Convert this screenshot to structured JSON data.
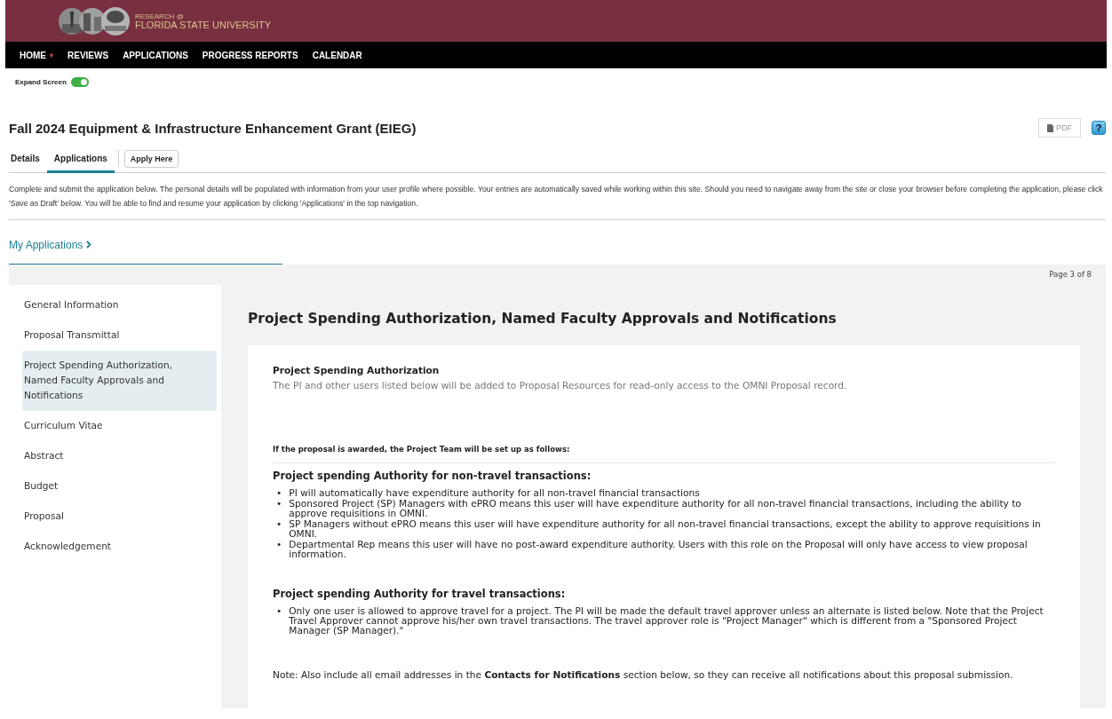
{
  "header": {
    "logo_line1": "RESEARCH @",
    "logo_line2": "FLORIDA STATE UNIVERSITY"
  },
  "nav": [
    {
      "label": "HOME",
      "caret": "▾"
    },
    {
      "label": "REVIEWS"
    },
    {
      "label": "APPLICATIONS"
    },
    {
      "label": "PROGRESS REPORTS"
    },
    {
      "label": "CALENDAR"
    }
  ],
  "expand_screen": {
    "label": "Expand Screen",
    "on": true
  },
  "title": "Fall 2024 Equipment & Infrastructure Enhancement Grant (EIEG)",
  "pdf_button": "PDF",
  "help_button": "?",
  "tabs": [
    {
      "label": "Details",
      "selected": false
    },
    {
      "label": "Applications",
      "selected": true
    }
  ],
  "apply_button": "Apply Here",
  "intro": "Complete and submit the application below. The personal details will be populated with information from your user profile where possible. Your entries are automatically saved while working within this site. Should you need to navigate away from the site or close your browser before completing the application, please click 'Save as Draft' below. You will be able to find and resume your application by clicking 'Applications' in the top navigation.",
  "my_applications": "My Applications",
  "page_indicator": "Page 3 of 8",
  "steps": [
    {
      "label": "General Information",
      "selected": false
    },
    {
      "label": "Proposal Transmittal",
      "selected": false
    },
    {
      "label": "Project Spending Authorization, Named Faculty Approvals and Notifications",
      "selected": true
    },
    {
      "label": "Curriculum Vitae",
      "selected": false
    },
    {
      "label": "Abstract",
      "selected": false
    },
    {
      "label": "Budget",
      "selected": false
    },
    {
      "label": "Proposal",
      "selected": false
    },
    {
      "label": "Acknowledgement",
      "selected": false
    }
  ],
  "section_title": "Project Spending Authorization, Named Faculty Approvals and Notifications",
  "card": {
    "heading": "Project Spending Authorization",
    "subtext": "The PI and other users listed below will be added to Proposal Resources for read-only access to the OMNI Proposal record.",
    "awarded_note": "If the proposal is awarded, the Project Team will be set up as follows:",
    "bullet_marker": "•",
    "groups": [
      {
        "heading": "Project spending Authority for non-travel transactions:",
        "bullets": [
          "PI will automatically have expenditure authority for all non-travel financial transactions",
          "Sponsored Project (SP) Managers with ePRO means this user will have expenditure authority for all non-travel financial transactions, including the ability to approve requisitions in OMNI.",
          "SP Managers without ePRO means this user will have expenditure authority for all non-travel financial transactions, except the ability to approve requisitions in OMNI.",
          "Departmental Rep means this user will have no post-award expenditure authority. Users with this role on the Proposal will only have access to view proposal information."
        ]
      },
      {
        "heading": "Project spending Authority for travel transactions:",
        "bullets": [
          "Only one user is allowed to approve travel for a project. The PI will be made the default travel approver unless an alternate is listed below. Note that the Project Travel Approver cannot approve his/her own travel transactions. The travel approver role is \"Project Manager\" which is different from a \"Sponsored Project Manager (SP Manager).\""
        ]
      }
    ],
    "note": "Note: Also include all email addresses in the **Contacts for Notifications** section below, so they can receive all notifications about this proposal submission."
  }
}
